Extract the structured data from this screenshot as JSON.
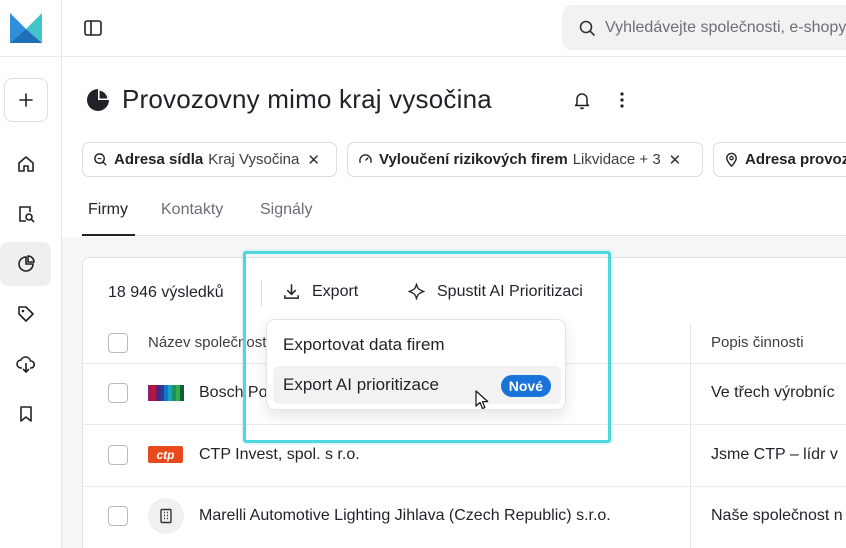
{
  "search": {
    "placeholder": "Vyhledávejte společnosti, e-shopy"
  },
  "page": {
    "title": "Provozovny mimo kraj vysočina"
  },
  "filters": [
    {
      "label": "Adresa sídla",
      "value": "Kraj Vysočina",
      "icon": "map-search-icon"
    },
    {
      "label": "Vyloučení rizikových firem",
      "value": "Likvidace + 3",
      "icon": "gauge-icon"
    },
    {
      "label": "Adresa provoz",
      "value": "",
      "icon": "location-pin-icon"
    }
  ],
  "tabs": [
    {
      "label": "Firmy"
    },
    {
      "label": "Kontakty"
    },
    {
      "label": "Signály"
    }
  ],
  "toolbar": {
    "count": "18 946 výsledků",
    "export_label": "Export",
    "ai_label": "Spustit AI Prioritizaci"
  },
  "table": {
    "headers": {
      "name": "Název společnosti",
      "desc": "Popis činnosti"
    },
    "rows": [
      {
        "name": "Bosch Po",
        "desc": "Ve třech výrobníc",
        "logo": "bosch-logo"
      },
      {
        "name": "CTP Invest, spol. s r.o.",
        "desc": "Jsme CTP – lídr v",
        "logo": "ctp-logo",
        "logo_text": "ctp"
      },
      {
        "name": "Marelli Automotive Lighting Jihlava (Czech Republic) s.r.o.",
        "desc": "Naše společnost n",
        "logo": "building-icon"
      }
    ]
  },
  "export_menu": {
    "items": [
      {
        "label": "Exportovat data firem"
      },
      {
        "label": "Export AI prioritizace",
        "badge": "Nové"
      }
    ]
  },
  "colors": {
    "accent_blue": "#1a73d9",
    "highlight": "#4fd6de",
    "ctp_orange": "#e8491d"
  }
}
